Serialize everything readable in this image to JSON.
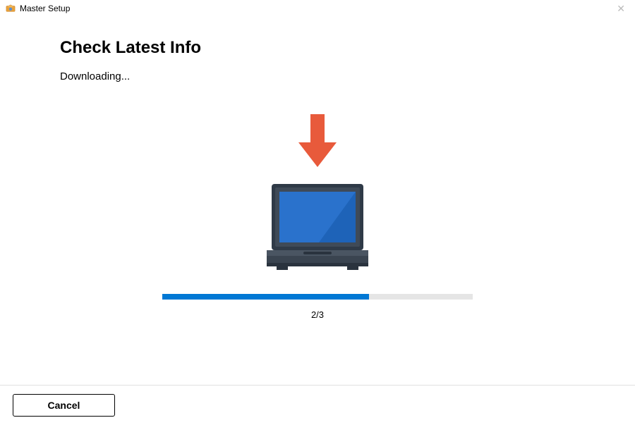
{
  "window": {
    "title": "Master Setup"
  },
  "page": {
    "heading": "Check Latest Info",
    "status": "Downloading..."
  },
  "progress": {
    "label": "2/3",
    "percent": 66.67
  },
  "footer": {
    "cancel_label": "Cancel"
  }
}
